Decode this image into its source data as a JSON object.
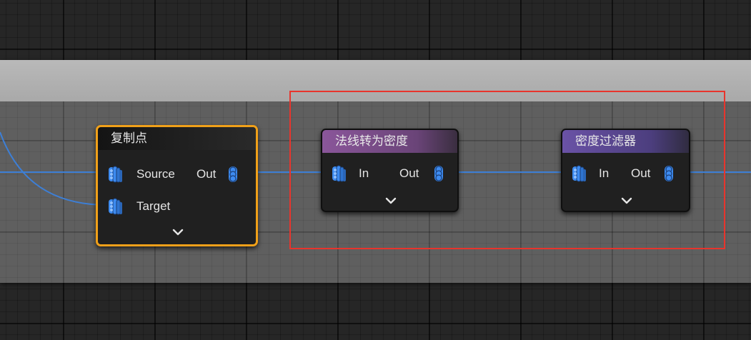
{
  "graph": {
    "nodes": [
      {
        "title": "复制点",
        "inputs": [
          "Source",
          "Target"
        ],
        "outputs": [
          "Out"
        ],
        "header_color": "#1e1e1e",
        "selected": true
      },
      {
        "title": "法线转为密度",
        "inputs": [
          "In"
        ],
        "outputs": [
          "Out"
        ],
        "header_color": "#7a4a88",
        "selected": false
      },
      {
        "title": "密度过滤器",
        "inputs": [
          "In"
        ],
        "outputs": [
          "Out"
        ],
        "header_color": "#5a4690",
        "selected": false
      }
    ],
    "wire_color": "#3d7fd6",
    "pin_color": "#3d8bf0",
    "selection_color": "#f0a019",
    "highlight_color": "#e8342c"
  }
}
